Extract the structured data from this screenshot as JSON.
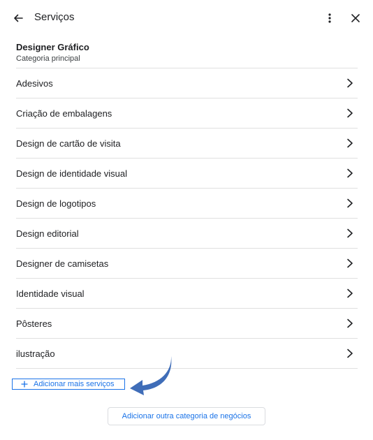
{
  "header": {
    "title": "Serviços",
    "back_icon": "arrow-back-icon",
    "more_icon": "more-vert-icon",
    "close_icon": "close-icon"
  },
  "category": {
    "name": "Designer Gráfico",
    "subtitle": "Categoria principal"
  },
  "services": [
    {
      "label": "Adesivos"
    },
    {
      "label": "Criação de embalagens"
    },
    {
      "label": "Design de cartão de visita"
    },
    {
      "label": "Design de identidade visual"
    },
    {
      "label": "Design de logotipos"
    },
    {
      "label": "Design editorial"
    },
    {
      "label": "Designer de camisetas"
    },
    {
      "label": "Identidade visual"
    },
    {
      "label": "Pôsteres"
    },
    {
      "label": "ilustração"
    }
  ],
  "actions": {
    "add_more_label": "Adicionar mais serviços",
    "add_category_label": "Adicionar outra categoria de negócios"
  },
  "colors": {
    "accent": "#1a73e8",
    "annotation_arrow": "#3f6db8",
    "divider": "#e0e0e0"
  }
}
